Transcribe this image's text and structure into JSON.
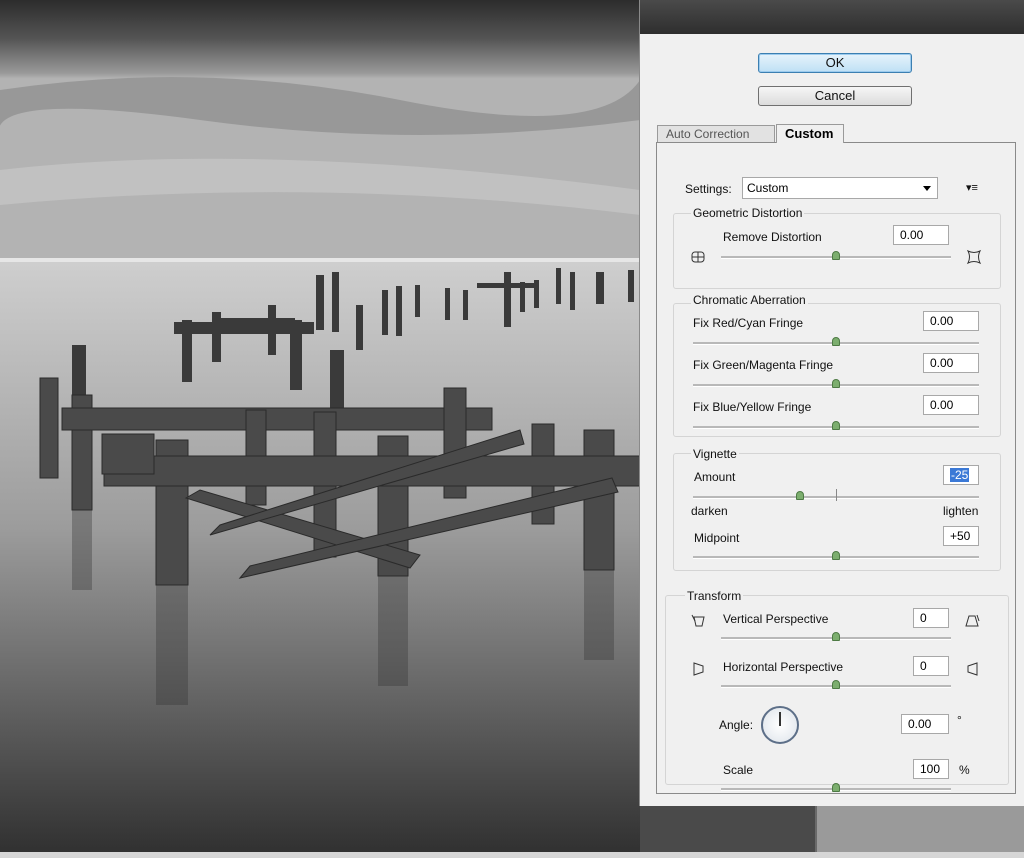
{
  "dialog": {
    "ok_label": "OK",
    "cancel_label": "Cancel"
  },
  "tabs": [
    {
      "label": "Auto Correction",
      "selected": false
    },
    {
      "label": "Custom",
      "selected": true
    }
  ],
  "settings": {
    "label": "Settings:",
    "value": "Custom",
    "menu_glyph": "▾≡"
  },
  "geometric": {
    "title": "Geometric Distortion",
    "remove_label": "Remove Distortion",
    "remove_value": "0.00",
    "remove_level": 0.5
  },
  "chromatic": {
    "title": "Chromatic Aberration",
    "rows": [
      {
        "label": "Fix Red/Cyan Fringe",
        "value": "0.00",
        "level": 0.5
      },
      {
        "label": "Fix Green/Magenta Fringe",
        "value": "0.00",
        "level": 0.5
      },
      {
        "label": "Fix Blue/Yellow Fringe",
        "value": "0.00",
        "level": 0.5
      }
    ]
  },
  "vignette": {
    "title": "Vignette",
    "amount_label": "Amount",
    "amount_value": "-25",
    "amount_level": 0.375,
    "darken_label": "darken",
    "lighten_label": "lighten",
    "midpoint_label": "Midpoint",
    "midpoint_value": "+50",
    "midpoint_level": 0.5
  },
  "transform": {
    "title": "Transform",
    "vertical_label": "Vertical Perspective",
    "vertical_value": "0",
    "vertical_level": 0.5,
    "horizontal_label": "Horizontal Perspective",
    "horizontal_value": "0",
    "horizontal_level": 0.5,
    "angle_label": "Angle:",
    "angle_value": "0.00",
    "angle_unit": "°",
    "scale_label": "Scale",
    "scale_value": "100",
    "scale_unit": "%",
    "scale_level": 0.5
  },
  "colors": {
    "ok_accent": "#3c7fb1",
    "thumb": "#7cae6e",
    "selection": "#3b79d6"
  }
}
